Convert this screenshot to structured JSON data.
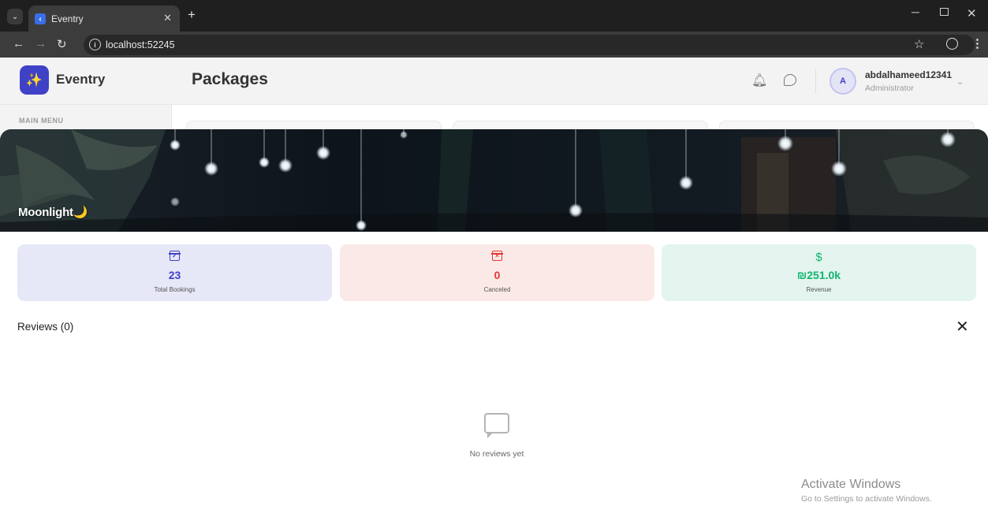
{
  "browser": {
    "tab_title": "Eventry",
    "url": "localhost:52245"
  },
  "header": {
    "brand": "Eventry",
    "page_title": "Packages",
    "user_name": "abdalhameed12341",
    "user_role": "Administrator",
    "avatar_letter": "A"
  },
  "sidebar": {
    "section_label": "MAIN MENU"
  },
  "package": {
    "name": "Moonlight",
    "name_emoji": "🌙"
  },
  "stats": [
    {
      "label": "Total Bookings",
      "value": "23",
      "color": "#3f42c7",
      "bg": "#e6e7f7",
      "icon": "calendar-check-icon"
    },
    {
      "label": "Canceled",
      "value": "0",
      "color": "#e53935",
      "bg": "#fbe9e7",
      "icon": "calendar-x-icon"
    },
    {
      "label": "Revenue",
      "value": "₪251.0k",
      "color": "#12b36f",
      "bg": "#e3f5ee",
      "icon": "dollar-icon",
      "symbol": "$"
    }
  ],
  "reviews": {
    "title": "Reviews (0)",
    "empty_text": "No reviews yet"
  },
  "watermark": {
    "title": "Activate Windows",
    "subtitle": "Go to Settings to activate Windows."
  }
}
